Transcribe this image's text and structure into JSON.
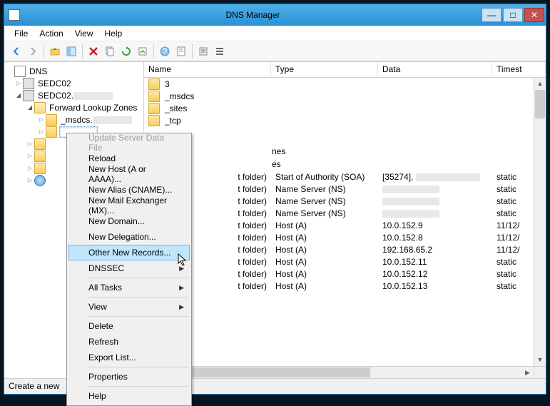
{
  "window": {
    "title": "DNS Manager"
  },
  "menubar": [
    "File",
    "Action",
    "View",
    "Help"
  ],
  "tree": {
    "root": "DNS",
    "server1": "SEDC02",
    "server2": "SEDC02.",
    "flz": "Forward Lookup Zones",
    "zone1": "_msdcs.",
    "rlz_visible_label": ""
  },
  "columns": {
    "name": "Name",
    "type": "Type",
    "data": "Data",
    "ts": "Timest"
  },
  "rows": [
    {
      "kind": "folder",
      "name": "3",
      "type": "",
      "data": "",
      "ts": ""
    },
    {
      "kind": "folder",
      "name": "_msdcs",
      "type": "",
      "data": "",
      "ts": ""
    },
    {
      "kind": "folder",
      "name": "_sites",
      "type": "",
      "data": "",
      "ts": ""
    },
    {
      "kind": "folder",
      "name": "_tcp",
      "type": "",
      "data": "",
      "ts": ""
    },
    {
      "kind": "gap",
      "name": "",
      "type": "",
      "data": "",
      "ts": ""
    },
    {
      "kind": "textpartial",
      "name": "nes",
      "type": "",
      "data": "",
      "ts": ""
    },
    {
      "kind": "textpartial",
      "name": "es",
      "type": "",
      "data": "",
      "ts": ""
    },
    {
      "kind": "gap",
      "name": "",
      "type": "",
      "data": "",
      "ts": ""
    },
    {
      "kind": "partial",
      "name": "t folder)",
      "type": "Start of Authority (SOA)",
      "data": "[35274],",
      "ts": "static"
    },
    {
      "kind": "partial",
      "name": "t folder)",
      "type": "Name Server (NS)",
      "data": "",
      "ts": "static"
    },
    {
      "kind": "partial",
      "name": "t folder)",
      "type": "Name Server (NS)",
      "data": "",
      "ts": "static"
    },
    {
      "kind": "partial",
      "name": "t folder)",
      "type": "Name Server (NS)",
      "data": "",
      "ts": "static"
    },
    {
      "kind": "partial",
      "name": "t folder)",
      "type": "Host (A)",
      "data": "10.0.152.9",
      "ts": "11/12/"
    },
    {
      "kind": "partial",
      "name": "t folder)",
      "type": "Host (A)",
      "data": "10.0.152.8",
      "ts": "11/12/"
    },
    {
      "kind": "partial",
      "name": "t folder)",
      "type": "Host (A)",
      "data": "192.168.65.2",
      "ts": "11/12/"
    },
    {
      "kind": "partial",
      "name": "t folder)",
      "type": "Host (A)",
      "data": "10.0.152.11",
      "ts": "static"
    },
    {
      "kind": "partial",
      "name": "t folder)",
      "type": "Host (A)",
      "data": "10.0.152.12",
      "ts": "static"
    },
    {
      "kind": "partial",
      "name": "t folder)",
      "type": "Host (A)",
      "data": "10.0.152.13",
      "ts": "static"
    }
  ],
  "context_menu": [
    {
      "label": "Update Server Data File",
      "disabled": true
    },
    {
      "label": "Reload"
    },
    {
      "label": "New Host (A or AAAA)..."
    },
    {
      "label": "New Alias (CNAME)..."
    },
    {
      "label": "New Mail Exchanger (MX)..."
    },
    {
      "label": "New Domain..."
    },
    {
      "label": "New Delegation..."
    },
    {
      "label": "Other New Records...",
      "highlight": true
    },
    {
      "label": "DNSSEC",
      "submenu": true
    },
    {
      "sep": true
    },
    {
      "label": "All Tasks",
      "submenu": true
    },
    {
      "sep": true
    },
    {
      "label": "View",
      "submenu": true
    },
    {
      "sep": true
    },
    {
      "label": "Delete"
    },
    {
      "label": "Refresh"
    },
    {
      "label": "Export List..."
    },
    {
      "sep": true
    },
    {
      "label": "Properties"
    },
    {
      "sep": true
    },
    {
      "label": "Help"
    }
  ],
  "statusbar": "Create a new",
  "redacted_widths": {
    "soa_data": 90,
    "ns_data": 80
  }
}
